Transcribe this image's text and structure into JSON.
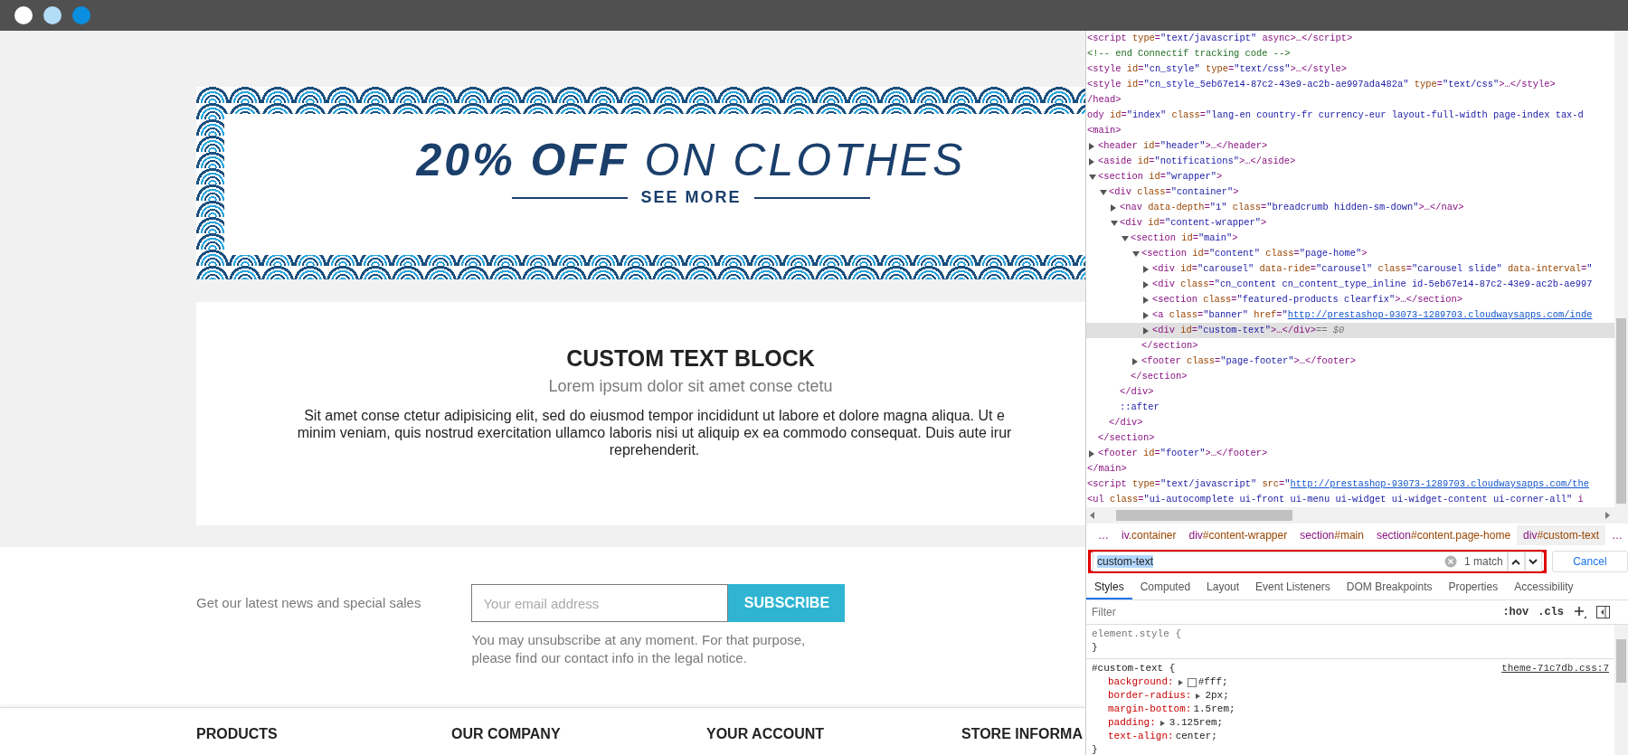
{
  "window": {
    "dots": [
      {
        "color": "#ffffff"
      },
      {
        "color": "#b3dcf7"
      },
      {
        "color": "#0a8ee0"
      }
    ]
  },
  "page": {
    "banner": {
      "title": "**20% OFF** ON CLOTHES",
      "link": "SEE MORE"
    },
    "custom_text": {
      "heading": "CUSTOM TEXT BLOCK",
      "subtitle": "Lorem ipsum dolor sit amet conse ctetu",
      "lines": [
        "Sit amet conse ctetur adipisicing elit, sed do eiusmod tempor incididunt ut labore et dolore magna aliqua. Ut e",
        "minim veniam, quis nostrud exercitation ullamco laboris nisi ut aliquip ex ea commodo consequat. Duis aute irur",
        "reprehenderit."
      ]
    },
    "newsletter": {
      "label": "Get our latest news and special sales",
      "placeholder": "Your email address",
      "button": "SUBSCRIBE",
      "note": "You may unsubscribe at any moment. For that purpose, please find our contact info in the legal notice."
    },
    "footer_headings": [
      "PRODUCTS",
      "OUR COMPANY",
      "YOUR ACCOUNT",
      "STORE INFORMA"
    ]
  },
  "devtools": {
    "dom": {
      "nodes": [
        {
          "text": "<script type=\"text/javascript\" async>…</script>",
          "kind": "element",
          "selected": false
        },
        {
          "text": "<!-- end Connectif tracking code -->",
          "kind": "comment",
          "selected": false
        },
        {
          "text": "<style id=\"cn_style\" type=\"text/css\">…</style>",
          "kind": "element",
          "selected": false
        },
        {
          "text": "<style id=\"cn_style_5eb67e14-87c2-43e9-ac2b-ae997ada482a\" type=\"text/css\">…</style>",
          "kind": "element",
          "selected": false
        },
        {
          "text": "/head>",
          "kind": "element",
          "selected": false
        },
        {
          "text": "ody id=\"index\" class=\"lang-en country-fr currency-eur layout-full-width page-index tax-d",
          "kind": "element",
          "selected": false
        },
        {
          "text": "<main>",
          "kind": "element",
          "selected": false,
          "close": "</main>",
          "children": [
            {
              "text": "<header id=\"header\">…</header>",
              "kind": "element",
              "expanded": false,
              "selected": false
            },
            {
              "text": "<aside id=\"notifications\">…</aside>",
              "kind": "element",
              "expanded": false,
              "selected": false
            },
            {
              "text": "<section id=\"wrapper\">",
              "kind": "element",
              "expanded": true,
              "selected": false,
              "close": "</section>",
              "children": [
                {
                  "text": "<div class=\"container\">",
                  "kind": "element",
                  "expanded": true,
                  "selected": false,
                  "close": "</div>",
                  "children": [
                    {
                      "text": "<nav data-depth=\"1\" class=\"breadcrumb hidden-sm-down\">…</nav>",
                      "kind": "element",
                      "expanded": false,
                      "selected": false
                    },
                    {
                      "text": "<div id=\"content-wrapper\">",
                      "kind": "element",
                      "expanded": true,
                      "selected": false,
                      "close": "</div>",
                      "children": [
                        {
                          "text": "<section id=\"main\">",
                          "kind": "element",
                          "expanded": true,
                          "selected": false,
                          "close": "</section>",
                          "children": [
                            {
                              "text": "<section id=\"content\" class=\"page-home\">",
                              "kind": "element",
                              "expanded": true,
                              "selected": false,
                              "close": "</section>",
                              "children": [
                                {
                                  "text": "<div id=\"carousel\" data-ride=\"carousel\" class=\"carousel slide\" data-interval=\"",
                                  "kind": "element",
                                  "expanded": false,
                                  "selected": false
                                },
                                {
                                  "text": "<div class=\"cn_content cn_content_type_inline id-5eb67e14-87c2-43e9-ac2b-ae997",
                                  "kind": "element",
                                  "expanded": false,
                                  "selected": false
                                },
                                {
                                  "text": "<section class=\"featured-products clearfix\">…</section>",
                                  "kind": "element",
                                  "expanded": false,
                                  "selected": false
                                },
                                {
                                  "text": "<a class=\"banner\" href=\"http://prestashop-93073-1289703.cloudwaysapps.com/inde",
                                  "kind": "element",
                                  "expanded": false,
                                  "selected": false
                                },
                                {
                                  "text": "<div id=\"custom-text\">…</div>",
                                  "kind": "element",
                                  "expanded": false,
                                  "selected": true,
                                  "ref": "== $0"
                                }
                              ]
                            },
                            {
                              "text": "<footer class=\"page-footer\">…</footer>",
                              "kind": "element",
                              "expanded": false,
                              "selected": false
                            }
                          ]
                        }
                      ]
                    },
                    {
                      "text": "::after",
                      "kind": "pseudo",
                      "selected": false
                    }
                  ]
                }
              ]
            },
            {
              "text": "<footer id=\"footer\">…</footer>",
              "kind": "element",
              "expanded": false,
              "selected": false
            }
          ]
        },
        {
          "text": "<script type=\"text/javascript\" src=\"http://prestashop-93073-1289703.cloudwaysapps.com/the",
          "kind": "element",
          "selected": false
        },
        {
          "text": "<ul class=\"ui-autocomplete ui-front ui-menu ui-widget ui-widget-content ui-corner-all\" i",
          "kind": "element",
          "selected": false
        }
      ]
    },
    "breadcrumbs": [
      {
        "text": "…",
        "selected": false
      },
      {
        "text": "iv.container",
        "selected": false
      },
      {
        "text": "div#content-wrapper",
        "selected": false
      },
      {
        "text": "section#main",
        "selected": false
      },
      {
        "text": "section#content.page-home",
        "selected": false
      },
      {
        "text": "div#custom-text",
        "selected": true
      },
      {
        "text": "…",
        "selected": false
      }
    ],
    "search": {
      "value": "custom-text",
      "matches": "1 match",
      "cancel": "Cancel"
    },
    "tabs": [
      {
        "label": "Styles",
        "selected": true
      },
      {
        "label": "Computed",
        "selected": false
      },
      {
        "label": "Layout",
        "selected": false
      },
      {
        "label": "Event Listeners",
        "selected": false
      },
      {
        "label": "DOM Breakpoints",
        "selected": false
      },
      {
        "label": "Properties",
        "selected": false
      },
      {
        "label": "Accessibility",
        "selected": false
      }
    ],
    "filter": {
      "placeholder": "Filter",
      "hov": ":hov",
      "cls": ".cls"
    },
    "rules": [
      {
        "selector": "element.style",
        "open": "{",
        "close": "}"
      },
      {
        "selector": "#custom-text",
        "open": "{",
        "close": "}",
        "source": "theme-71c7db.css:7",
        "properties": [
          {
            "name": "background:",
            "value": "#fff;",
            "expandable": true,
            "swatch": true
          },
          {
            "name": "border-radius:",
            "value": "2px;",
            "expandable": true
          },
          {
            "name": "margin-bottom:",
            "value": "1.5rem;",
            "expandable": false
          },
          {
            "name": "padding:",
            "value": "3.125rem;",
            "expandable": true
          },
          {
            "name": "text-align:",
            "value": "center;",
            "expandable": false
          }
        ]
      }
    ]
  }
}
